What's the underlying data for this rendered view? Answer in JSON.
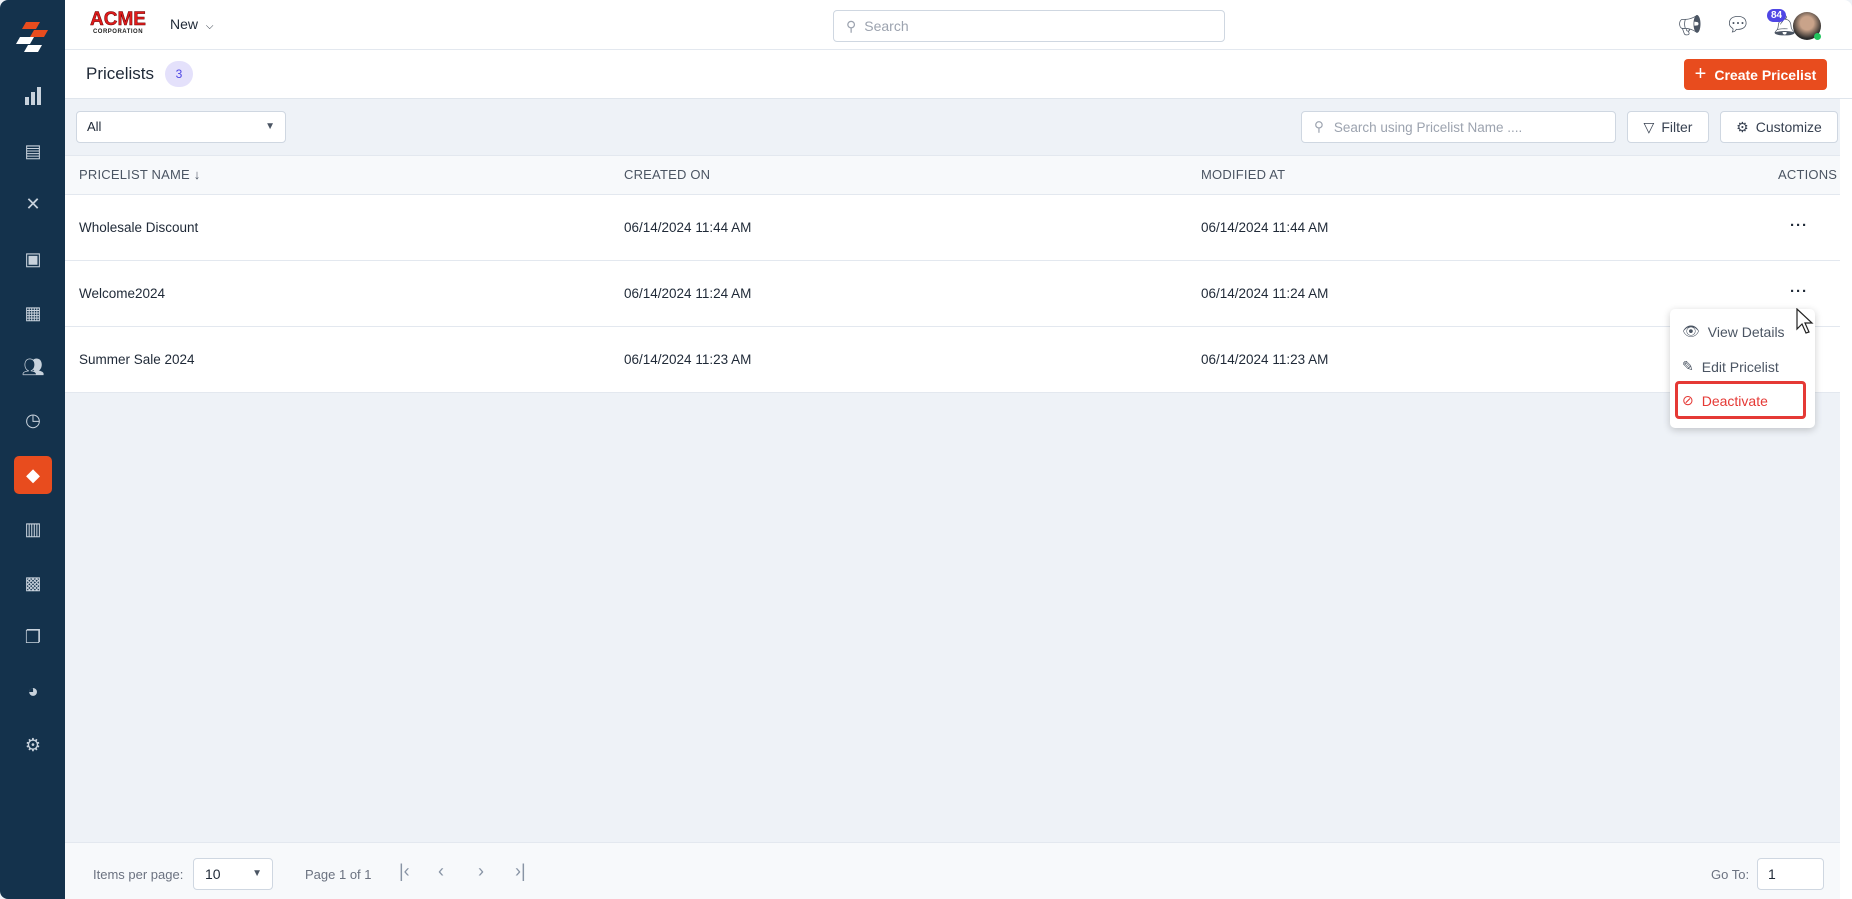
{
  "app": {
    "logo_text": "ACME",
    "logo_sub": "CORPORATION",
    "new_label": "New",
    "search_placeholder": "Search",
    "notification_count": "84",
    "accent": "#e84c1e"
  },
  "sidebar": {
    "items": [
      {
        "icon": "bar-chart-icon"
      },
      {
        "icon": "clipboard-icon"
      },
      {
        "icon": "tools-icon"
      },
      {
        "icon": "briefcase-icon"
      },
      {
        "icon": "calendar-icon"
      },
      {
        "icon": "users-icon"
      },
      {
        "icon": "clock-icon"
      },
      {
        "icon": "tag-icon",
        "active": true
      },
      {
        "icon": "map-icon"
      },
      {
        "icon": "calculator-icon"
      },
      {
        "icon": "documents-icon"
      },
      {
        "icon": "pie-chart-icon"
      },
      {
        "icon": "gear-icon"
      }
    ]
  },
  "header": {
    "title": "Pricelists",
    "count": "3",
    "create_label": "Create Pricelist"
  },
  "toolbar": {
    "filter_select": "All",
    "search_placeholder": "Search using Pricelist Name ....",
    "filter_label": "Filter",
    "customize_label": "Customize"
  },
  "table": {
    "columns": [
      "PRICELIST NAME",
      "CREATED ON",
      "MODIFIED AT",
      "ACTIONS"
    ],
    "rows": [
      {
        "name": "Wholesale Discount",
        "created": "06/14/2024 11:44 AM",
        "modified": "06/14/2024 11:44 AM"
      },
      {
        "name": "Welcome2024",
        "created": "06/14/2024 11:24 AM",
        "modified": "06/14/2024 11:24 AM"
      },
      {
        "name": "Summer Sale 2024",
        "created": "06/14/2024 11:23 AM",
        "modified": "06/14/2024 11:23 AM"
      }
    ]
  },
  "menu": {
    "items": [
      "View Details",
      "Edit Pricelist",
      "Deactivate"
    ]
  },
  "footer": {
    "items_per_page_label": "Items per page:",
    "items_per_page": "10",
    "page_info": "Page 1 of 1",
    "goto_label": "Go To:",
    "goto_value": "1"
  }
}
